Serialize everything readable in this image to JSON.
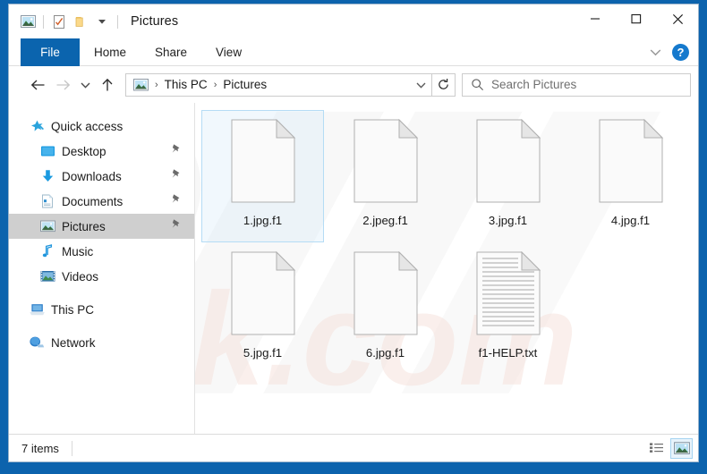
{
  "window": {
    "title": "Pictures",
    "app_icon": "pictures-folder-icon",
    "quick_access": [
      {
        "name": "properties-icon",
        "glyph": "checklist"
      },
      {
        "name": "new-folder-icon",
        "glyph": "folder"
      },
      {
        "name": "customize-qat-chevron-icon",
        "glyph": "▾"
      }
    ],
    "controls": {
      "minimize": "—",
      "maximize": "□",
      "close": "✕"
    },
    "frame_color": "#0c63ad"
  },
  "ribbon": {
    "tabs": [
      {
        "label": "File",
        "active": true
      },
      {
        "label": "Home",
        "active": false
      },
      {
        "label": "Share",
        "active": false
      },
      {
        "label": "View",
        "active": false
      }
    ],
    "collapse_icon": "chevron-down-icon",
    "help_label": "?",
    "file_tab_color": "#0b64ae"
  },
  "nav": {
    "back": "←",
    "forward": "→",
    "recent": "˅",
    "up": "↑",
    "refresh": "↻"
  },
  "address": {
    "icon": "pictures-folder-icon",
    "crumbs": [
      "This PC",
      "Pictures"
    ],
    "separator": "›",
    "dropdown_icon": "chevron-down-icon"
  },
  "search": {
    "placeholder": "Search Pictures",
    "icon": "search-icon",
    "value": ""
  },
  "sidebar": {
    "items": [
      {
        "label": "Quick access",
        "icon": "star-pin-icon",
        "indent": 2,
        "selected": false,
        "pinned": false
      },
      {
        "label": "Desktop",
        "icon": "desktop-icon",
        "indent": 1,
        "selected": false,
        "pinned": true
      },
      {
        "label": "Downloads",
        "icon": "download-icon",
        "indent": 1,
        "selected": false,
        "pinned": true
      },
      {
        "label": "Documents",
        "icon": "documents-icon",
        "indent": 1,
        "selected": false,
        "pinned": true
      },
      {
        "label": "Pictures",
        "icon": "pictures-icon",
        "indent": 1,
        "selected": true,
        "pinned": true
      },
      {
        "label": "Music",
        "icon": "music-icon",
        "indent": 1,
        "selected": false,
        "pinned": false
      },
      {
        "label": "Videos",
        "icon": "videos-icon",
        "indent": 1,
        "selected": false,
        "pinned": false
      },
      {
        "label": "This PC",
        "icon": "this-pc-icon",
        "indent": 2,
        "selected": false,
        "pinned": false
      },
      {
        "label": "Network",
        "icon": "network-icon",
        "indent": 2,
        "selected": false,
        "pinned": false
      }
    ]
  },
  "files": [
    {
      "name": "1.jpg.f1",
      "icon": "blank-file-icon",
      "selected": true
    },
    {
      "name": "2.jpeg.f1",
      "icon": "blank-file-icon",
      "selected": false
    },
    {
      "name": "3.jpg.f1",
      "icon": "blank-file-icon",
      "selected": false
    },
    {
      "name": "4.jpg.f1",
      "icon": "blank-file-icon",
      "selected": false
    },
    {
      "name": "5.jpg.f1",
      "icon": "blank-file-icon",
      "selected": false
    },
    {
      "name": "6.jpg.f1",
      "icon": "blank-file-icon",
      "selected": false
    },
    {
      "name": "f1-HELP.txt",
      "icon": "text-file-icon",
      "selected": false
    }
  ],
  "status": {
    "item_count": "7 items",
    "views": [
      {
        "name": "details-view-button",
        "active": false
      },
      {
        "name": "large-icons-view-button",
        "active": true
      }
    ]
  },
  "watermark": {
    "text": "risk.com"
  }
}
